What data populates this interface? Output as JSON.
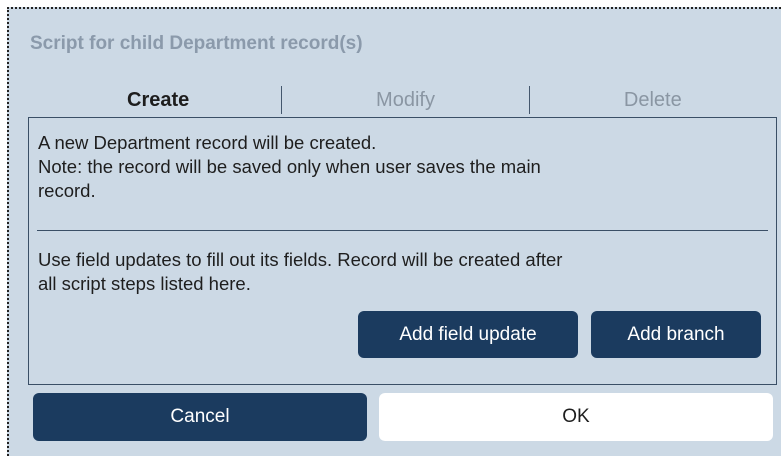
{
  "dialog": {
    "title": "Script for child Department record(s)"
  },
  "tabs": [
    {
      "label": "Create",
      "active": true
    },
    {
      "label": "Modify",
      "active": false
    },
    {
      "label": "Delete",
      "active": false
    }
  ],
  "panel": {
    "intro_lines": [
      "A new Department record will be created.",
      "Note: the record will be saved only when user saves the main",
      "record."
    ],
    "help_lines": [
      "Use field updates to fill out its fields. Record will be created after",
      "all script steps listed here."
    ],
    "add_field_update_label": "Add field update",
    "add_branch_label": "Add branch"
  },
  "footer": {
    "cancel_label": "Cancel",
    "ok_label": "OK"
  },
  "colors": {
    "dialog_background": "#ccd9e5",
    "dark_button": "#1b3b5f",
    "light_button": "#ffffff",
    "border": "#3a4f66",
    "muted_text": "#8b9aab"
  }
}
